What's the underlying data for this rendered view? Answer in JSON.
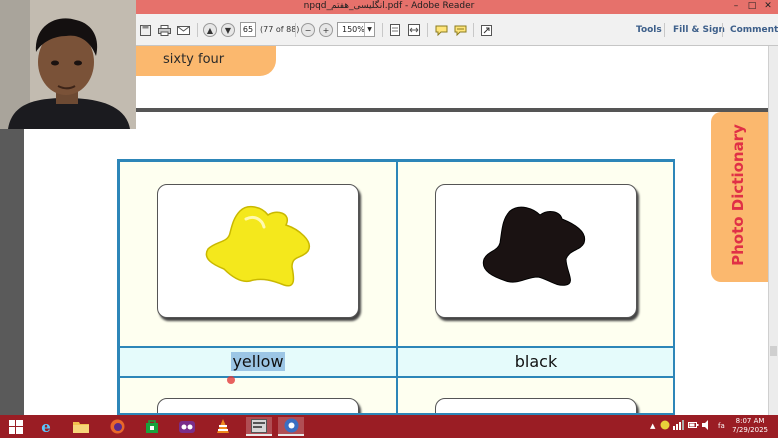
{
  "window": {
    "title": "npqd_انگلیسی_هفتم.pdf - Adobe Reader",
    "controls": [
      "–",
      "□",
      "✕"
    ]
  },
  "toolbar": {
    "page_number": "65",
    "page_of": "(77 of 88)",
    "zoom": "150%",
    "tools_label": "Tools",
    "fill_sign_label": "Fill & Sign",
    "comment_label": "Comment"
  },
  "document": {
    "page_header": "sixty four",
    "side_tab": "Photo Dictionary",
    "cells": [
      {
        "label": "yellow",
        "highlighted": true,
        "blob_color": "#f4e81c"
      },
      {
        "label": "black",
        "highlighted": false,
        "blob_color": "#1a1212"
      }
    ]
  },
  "taskbar": {
    "time": "8:07 AM",
    "date": "7/29/2025",
    "lang": "fa",
    "apps": [
      "start",
      "internet-explorer",
      "file-explorer",
      "firefox",
      "store",
      "app-purple",
      "vlc",
      "adobe-reader",
      "screen-recorder"
    ]
  },
  "colors": {
    "titlebar": "#e6716b",
    "taskbar": "#9a1d24",
    "tab_orange": "#fbb86e",
    "grid_blue": "#2d86b8",
    "side_tab_text": "#e03046",
    "link_blue": "#3d5f8a"
  }
}
